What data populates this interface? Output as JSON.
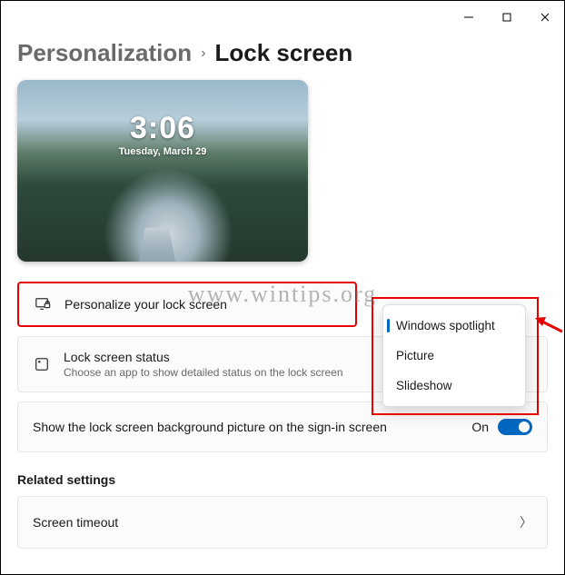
{
  "titlebar": {
    "min": "minimize",
    "max": "maximize",
    "close": "close"
  },
  "breadcrumb": {
    "parent": "Personalization",
    "separator": "›",
    "current": "Lock screen"
  },
  "preview": {
    "time": "3:06",
    "date": "Tuesday, March 29"
  },
  "rows": {
    "personalize": {
      "title": "Personalize your lock screen"
    },
    "status": {
      "title": "Lock screen status",
      "subtitle": "Choose an app to show detailed status on the lock screen"
    },
    "signin": {
      "title": "Show the lock screen background picture on the sign-in screen",
      "toggle_label": "On",
      "toggle_on": true
    }
  },
  "dropdown": {
    "items": [
      "Windows spotlight",
      "Picture",
      "Slideshow"
    ],
    "selected_index": 0
  },
  "related": {
    "heading": "Related settings",
    "timeout": "Screen timeout"
  },
  "watermark": "www.wintips.org",
  "colors": {
    "accent": "#0067c0",
    "annotation": "#e60000"
  }
}
